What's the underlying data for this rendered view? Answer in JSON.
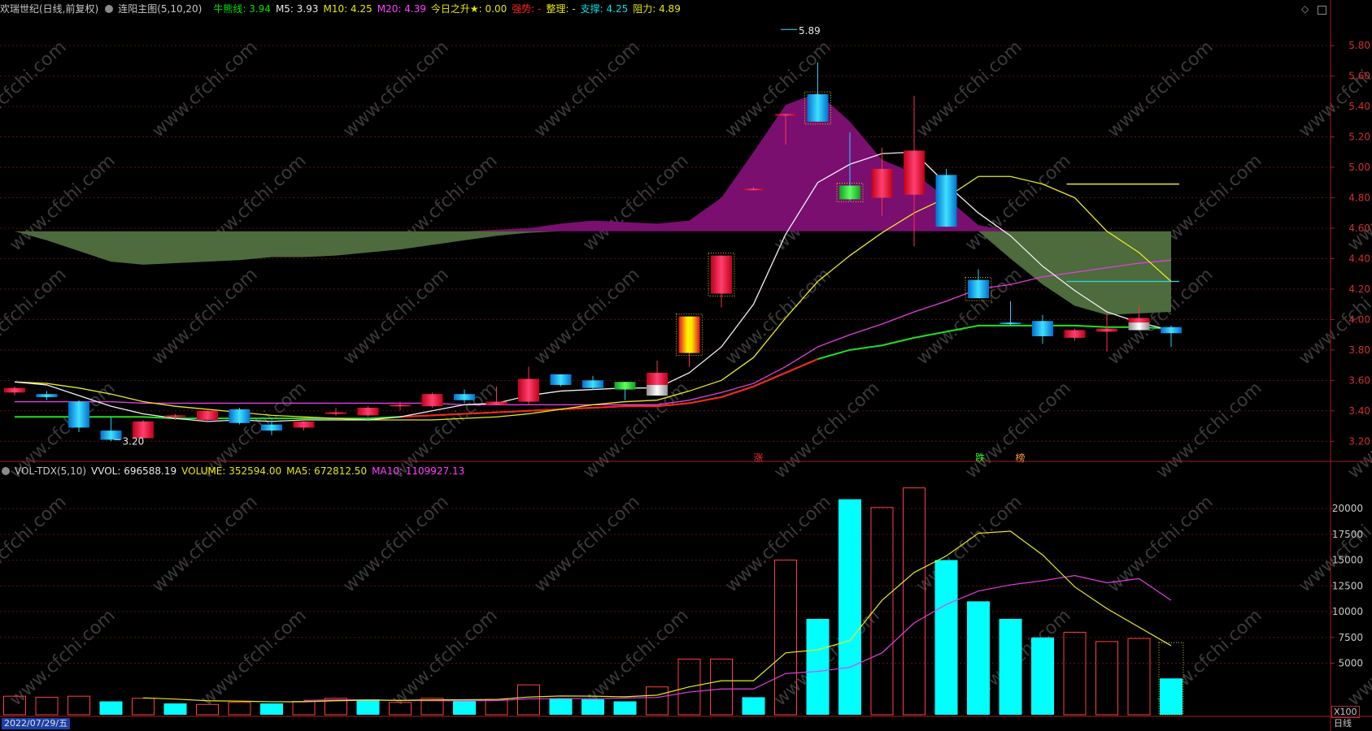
{
  "header_main": {
    "stock": "欢瑞世纪(日线,前复权)",
    "indicator": "连阳主图(5,10,20)",
    "items": [
      {
        "label": "牛熊线:",
        "value": "3.94",
        "color": "#00e000"
      },
      {
        "label": "M5:",
        "value": "3.93",
        "color": "#e8e8e8"
      },
      {
        "label": "M10:",
        "value": "4.25",
        "color": "#e8e800"
      },
      {
        "label": "M20:",
        "value": "4.39",
        "color": "#ff40ff"
      },
      {
        "label": "今日之升★:",
        "value": "0.00",
        "color": "#e8e800"
      },
      {
        "label": "强势:",
        "value": "-",
        "color": "#ff2020"
      },
      {
        "label": "整理:",
        "value": "-",
        "color": "#e8e800"
      },
      {
        "label": "支撑:",
        "value": "4.25",
        "color": "#00e0e0"
      },
      {
        "label": "阻力:",
        "value": "4.89",
        "color": "#e8e800"
      }
    ]
  },
  "header_vol": {
    "indicator": "VOL-TDX(5,10)",
    "items": [
      {
        "label": "VVOL:",
        "value": "696588.19",
        "color": "#e8e8e8"
      },
      {
        "label": "VOLUME:",
        "value": "352594.00",
        "color": "#e8e800"
      },
      {
        "label": "MA5:",
        "value": "672812.50",
        "color": "#e8e800"
      },
      {
        "label": "MA10:",
        "value": "1109927.13",
        "color": "#ff40ff"
      }
    ]
  },
  "footer": {
    "date": "2022/07/29/五",
    "period": "日线",
    "scale": "X100"
  },
  "chart_data": [
    {
      "type": "candlestick",
      "ylim": [
        3.1,
        5.95
      ],
      "y_ticks": [
        "5.80",
        "5.60",
        "5.40",
        "5.20",
        "5.00",
        "4.80",
        "4.60",
        "4.40",
        "4.20",
        "4.00",
        "3.80",
        "3.60",
        "3.40",
        "3.20"
      ],
      "annotations": {
        "high_label": "5.89",
        "low_label": "3.20",
        "signals": [
          "涨",
          "跌",
          "榜"
        ]
      },
      "candles": [
        {
          "o": 3.52,
          "h": 3.56,
          "l": 3.5,
          "c": 3.55
        },
        {
          "o": 3.51,
          "h": 3.53,
          "l": 3.47,
          "c": 3.49
        },
        {
          "o": 3.46,
          "h": 3.47,
          "l": 3.26,
          "c": 3.29
        },
        {
          "o": 3.27,
          "h": 3.36,
          "l": 3.2,
          "c": 3.21
        },
        {
          "o": 3.22,
          "h": 3.34,
          "l": 3.22,
          "c": 3.33
        },
        {
          "o": 3.36,
          "h": 3.38,
          "l": 3.34,
          "c": 3.37
        },
        {
          "o": 3.34,
          "h": 3.4,
          "l": 3.33,
          "c": 3.4
        },
        {
          "o": 3.41,
          "h": 3.42,
          "l": 3.31,
          "c": 3.32
        },
        {
          "o": 3.31,
          "h": 3.33,
          "l": 3.24,
          "c": 3.27
        },
        {
          "o": 3.29,
          "h": 3.34,
          "l": 3.27,
          "c": 3.33
        },
        {
          "o": 3.38,
          "h": 3.42,
          "l": 3.37,
          "c": 3.39
        },
        {
          "o": 3.37,
          "h": 3.43,
          "l": 3.36,
          "c": 3.42
        },
        {
          "o": 3.44,
          "h": 3.46,
          "l": 3.4,
          "c": 3.44
        },
        {
          "o": 3.43,
          "h": 3.52,
          "l": 3.42,
          "c": 3.51
        },
        {
          "o": 3.51,
          "h": 3.54,
          "l": 3.45,
          "c": 3.47
        },
        {
          "o": 3.44,
          "h": 3.56,
          "l": 3.44,
          "c": 3.46
        },
        {
          "o": 3.46,
          "h": 3.69,
          "l": 3.44,
          "c": 3.61
        },
        {
          "o": 3.64,
          "h": 3.64,
          "l": 3.56,
          "c": 3.57
        },
        {
          "o": 3.6,
          "h": 3.63,
          "l": 3.54,
          "c": 3.55
        },
        {
          "o": 3.59,
          "h": 3.59,
          "l": 3.47,
          "c": 3.54
        },
        {
          "o": 3.52,
          "h": 3.73,
          "l": 3.51,
          "c": 3.65
        },
        {
          "o": 3.78,
          "h": 4.02,
          "l": 3.69,
          "c": 4.02
        },
        {
          "o": 4.17,
          "h": 4.42,
          "l": 4.08,
          "c": 4.42
        },
        {
          "o": 4.86,
          "h": 4.87,
          "l": 4.86,
          "c": 4.86
        },
        {
          "o": 5.35,
          "h": 5.35,
          "l": 5.15,
          "c": 5.35
        },
        {
          "o": 5.48,
          "h": 5.69,
          "l": 5.3,
          "c": 5.3
        },
        {
          "o": 4.88,
          "h": 5.23,
          "l": 4.78,
          "c": 4.79
        },
        {
          "o": 4.8,
          "h": 5.13,
          "l": 4.68,
          "c": 4.99
        },
        {
          "o": 4.82,
          "h": 5.47,
          "l": 4.48,
          "c": 5.11
        },
        {
          "o": 4.95,
          "h": 4.99,
          "l": 4.61,
          "c": 4.61
        },
        {
          "o": 4.26,
          "h": 4.33,
          "l": 4.14,
          "c": 4.14
        },
        {
          "o": 3.98,
          "h": 4.12,
          "l": 3.96,
          "c": 3.97
        },
        {
          "o": 3.99,
          "h": 4.03,
          "l": 3.84,
          "c": 3.89
        },
        {
          "o": 3.88,
          "h": 3.94,
          "l": 3.86,
          "c": 3.93
        },
        {
          "o": 3.92,
          "h": 4.04,
          "l": 3.79,
          "c": 3.94
        },
        {
          "o": 3.93,
          "h": 4.09,
          "l": 3.93,
          "c": 4.01
        },
        {
          "o": 3.95,
          "h": 3.96,
          "l": 3.82,
          "c": 3.91
        }
      ],
      "lines": {
        "M5": [
          3.59,
          3.57,
          3.5,
          3.43,
          3.38,
          3.35,
          3.33,
          3.34,
          3.33,
          3.34,
          3.34,
          3.34,
          3.36,
          3.4,
          3.44,
          3.45,
          3.5,
          3.53,
          3.54,
          3.55,
          3.55,
          3.65,
          3.82,
          4.1,
          4.56,
          4.9,
          5.02,
          5.09,
          5.1,
          4.89,
          4.7,
          4.55,
          4.35,
          4.19,
          4.05,
          3.98,
          3.93
        ],
        "M10": [
          3.59,
          3.58,
          3.55,
          3.51,
          3.46,
          3.43,
          3.41,
          3.39,
          3.37,
          3.36,
          3.35,
          3.34,
          3.34,
          3.34,
          3.35,
          3.36,
          3.38,
          3.41,
          3.44,
          3.46,
          3.47,
          3.53,
          3.6,
          3.75,
          4.01,
          4.25,
          4.42,
          4.57,
          4.7,
          4.8,
          4.94,
          4.94,
          4.89,
          4.8,
          4.58,
          4.44,
          4.25
        ],
        "M20": [
          3.46,
          3.46,
          3.46,
          3.46,
          3.45,
          3.45,
          3.45,
          3.45,
          3.45,
          3.45,
          3.45,
          3.45,
          3.45,
          3.45,
          3.44,
          3.44,
          3.44,
          3.44,
          3.44,
          3.44,
          3.44,
          3.47,
          3.52,
          3.58,
          3.69,
          3.82,
          3.9,
          3.97,
          4.05,
          4.12,
          4.2,
          4.23,
          4.28,
          4.31,
          4.34,
          4.37,
          4.39
        ],
        "牛熊线": [
          3.36,
          3.36,
          3.36,
          3.36,
          3.36,
          3.35,
          3.35,
          3.35,
          3.35,
          3.35,
          3.35,
          3.35,
          3.36,
          3.37,
          3.38,
          3.39,
          3.4,
          3.41,
          3.42,
          3.43,
          3.43,
          3.45,
          3.49,
          3.56,
          3.65,
          3.74,
          3.8,
          3.83,
          3.88,
          3.92,
          3.96,
          3.96,
          3.96,
          3.96,
          3.95,
          3.95,
          3.94
        ],
        "支撑": 4.25,
        "阻力": 4.89
      },
      "bands": {
        "base": 4.58,
        "green_band": [
          4.58,
          4.52,
          4.45,
          4.38,
          4.36,
          4.37,
          4.38,
          4.39,
          4.41,
          4.41,
          4.42,
          4.44,
          4.46,
          4.49,
          4.52,
          4.55,
          4.57,
          4.58,
          4.58,
          4.58,
          4.58,
          4.58,
          4.58,
          4.58,
          4.58,
          4.58,
          4.58,
          4.58,
          4.58,
          4.58,
          4.58,
          4.4,
          4.23,
          4.09,
          4.03,
          4.04,
          4.05
        ],
        "purple_band": [
          4.58,
          4.58,
          4.58,
          4.58,
          4.58,
          4.58,
          4.58,
          4.58,
          4.58,
          4.58,
          4.58,
          4.58,
          4.58,
          4.58,
          4.58,
          4.59,
          4.6,
          4.63,
          4.65,
          4.64,
          4.63,
          4.65,
          4.8,
          5.1,
          5.41,
          5.49,
          5.3,
          5.05,
          4.96,
          4.8,
          4.62,
          4.58,
          4.58,
          4.58,
          4.58,
          4.58,
          4.58
        ]
      }
    },
    {
      "type": "bar",
      "ylim": [
        0,
        23000
      ],
      "y_ticks": [
        "20000",
        "17500",
        "15000",
        "12500",
        "10000",
        "7500",
        "5000"
      ],
      "volume": [
        1800,
        1700,
        1800,
        1300,
        1600,
        1100,
        1000,
        1200,
        1100,
        1300,
        1600,
        1500,
        1200,
        1600,
        1400,
        1500,
        2900,
        1600,
        1500,
        1300,
        2700,
        5400,
        5400,
        1700,
        15000,
        9300,
        20900,
        20100,
        22000,
        15000,
        11000,
        9300,
        7500,
        8000,
        7100,
        7400,
        3525
      ],
      "ma5": [
        null,
        null,
        null,
        null,
        1640,
        1520,
        1360,
        1320,
        1260,
        1260,
        1360,
        1420,
        1400,
        1440,
        1460,
        1480,
        1720,
        1820,
        1800,
        1740,
        1900,
        2700,
        3300,
        3300,
        6000,
        6300,
        7200,
        11100,
        13800,
        15400,
        17600,
        17800,
        15500,
        12400,
        10300,
        8500,
        6700
      ],
      "ma10": [
        null,
        null,
        null,
        null,
        null,
        null,
        null,
        null,
        null,
        1390,
        1440,
        1460,
        1380,
        1370,
        1360,
        1380,
        1540,
        1580,
        1560,
        1620,
        1680,
        2200,
        2500,
        2500,
        4000,
        4200,
        4600,
        6000,
        8900,
        10700,
        12000,
        12600,
        13000,
        13500,
        12800,
        13200,
        11100
      ],
      "rise": [
        true,
        true,
        true,
        false,
        true,
        false,
        true,
        true,
        false,
        true,
        true,
        false,
        true,
        true,
        false,
        true,
        true,
        false,
        false,
        false,
        true,
        true,
        true,
        false,
        true,
        false,
        false,
        true,
        true,
        false,
        false,
        false,
        false,
        true,
        true,
        true,
        false
      ]
    }
  ]
}
